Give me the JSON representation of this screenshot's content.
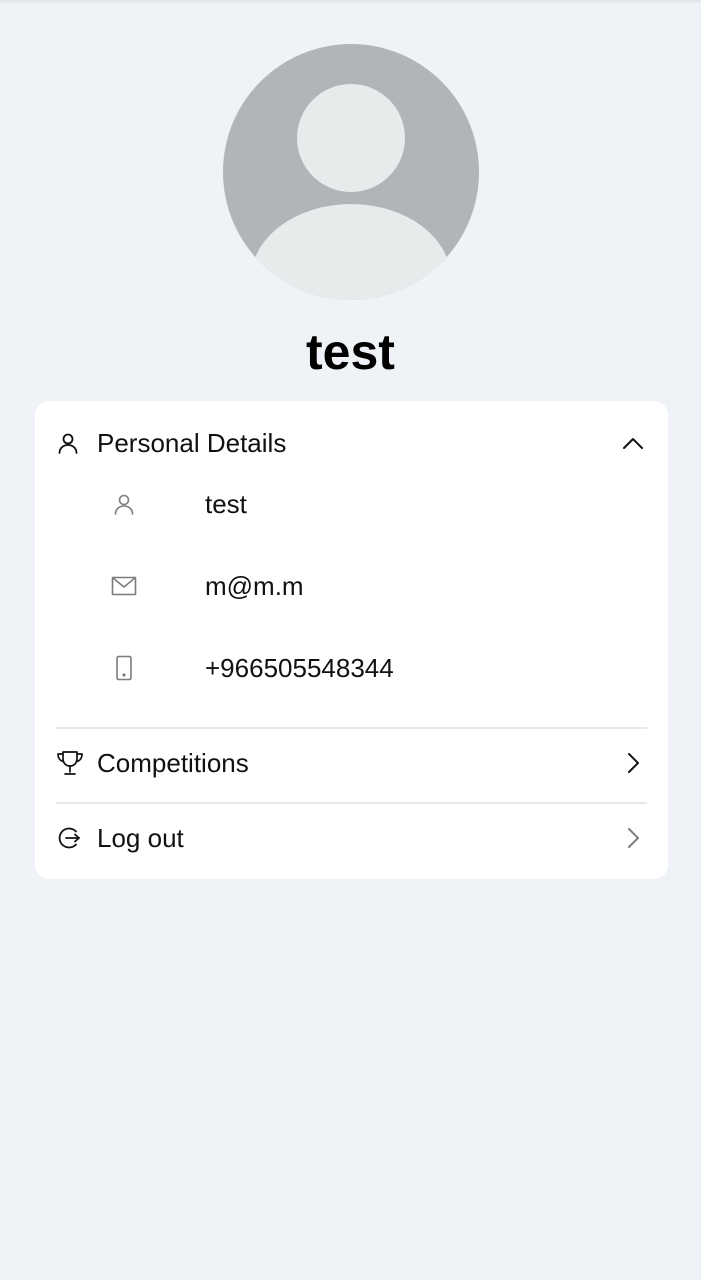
{
  "profile": {
    "name": "test"
  },
  "personal_details": {
    "title": "Personal Details",
    "expanded": true,
    "items": [
      {
        "icon": "user-icon",
        "value": "test"
      },
      {
        "icon": "mail-icon",
        "value": "m@m.m"
      },
      {
        "icon": "phone-icon",
        "value": "+966505548344"
      }
    ]
  },
  "menu": {
    "competitions": {
      "label": "Competitions",
      "icon": "trophy-icon"
    },
    "logout": {
      "label": "Log out",
      "icon": "logout-icon"
    }
  },
  "colors": {
    "background": "#eff3f8",
    "card": "#ffffff",
    "avatar_bg": "#b1b5b7",
    "avatar_fg": "#e8ebec",
    "muted_icon": "#7a7d80",
    "divider": "#e6e8eb"
  }
}
